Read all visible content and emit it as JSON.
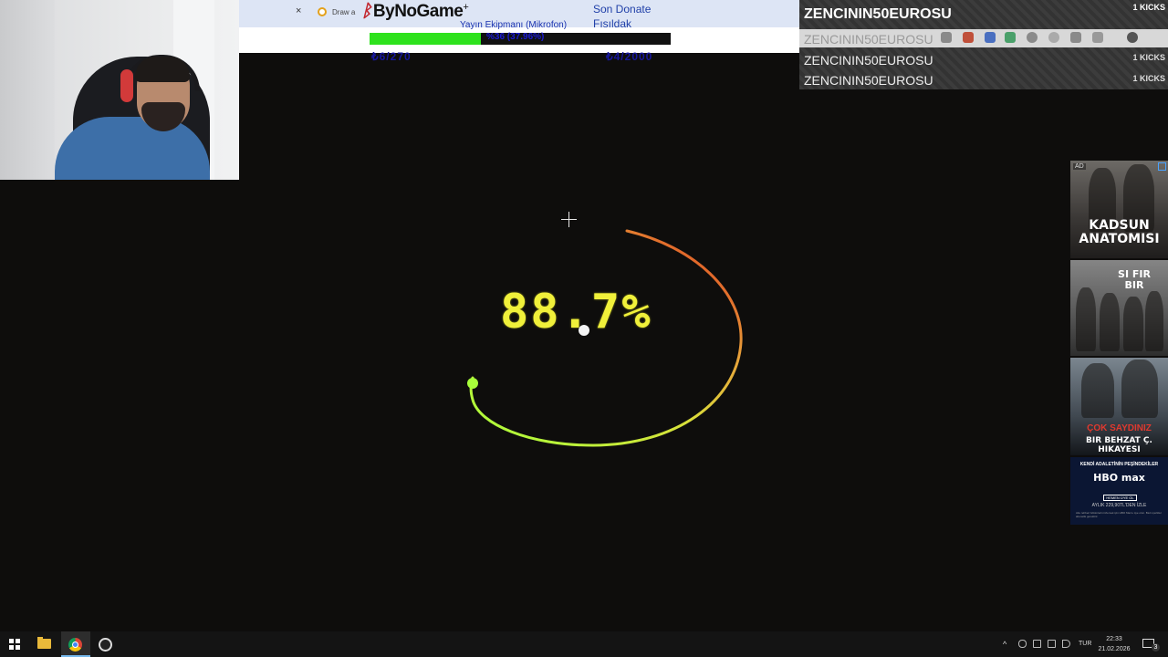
{
  "browser_tab": {
    "close": "×",
    "title": "Draw a"
  },
  "donation_widget": {
    "brand": "ByNoGame",
    "brand_plus": "+",
    "goal_title": "Yayın Ekipmanı (Mikrofon)",
    "progress_fraction": 0.37,
    "progress_text": "%36 (37.96%)",
    "current_amount": "₺6/270",
    "target_amount": "₺4/2000",
    "son_donate": "Son Donate",
    "fisildak": "Fısıldak"
  },
  "kicks_panel": {
    "rows": [
      {
        "name": "ZENCININ50EUROSU",
        "count": "1 KICKS"
      },
      {
        "name": "ZENCININ50EUROSU",
        "count": ""
      },
      {
        "name": "ZENCININ50EUROSU",
        "count": "1 KICKS"
      },
      {
        "name": "ZENCININ50EUROSU",
        "count": "1 KICKS"
      }
    ]
  },
  "game": {
    "score": "88.7%",
    "arc_colors": [
      "#a8ff3a",
      "#d8e03a",
      "#e8a23a",
      "#d92a1a"
    ]
  },
  "ads": {
    "badge": "AD",
    "items": [
      {
        "title": "KADSUN ANATOMISI"
      },
      {
        "title": "SI FIR BIR"
      },
      {
        "subtitle": "ÇOK SAYDINIZ",
        "title": "BIR BEHZAT Ç. HIKAYESI"
      },
      {
        "tagline": "KENDİ ADALETİNİN PEŞİNDEKİLER",
        "title": "HBO max",
        "cta": "HEMEN ÜYE OL",
        "price": "AYLIK 229,90TL'DEN İZLE",
        "fine": "Aile rehberi bölümlerini izlemek için HBO Max'e üye olun. Bazı içerikler abonelik gerektirir."
      }
    ]
  },
  "taskbar": {
    "language": "TUR",
    "time": "22:33",
    "date": "21.02.2026",
    "notification_count": "3"
  }
}
